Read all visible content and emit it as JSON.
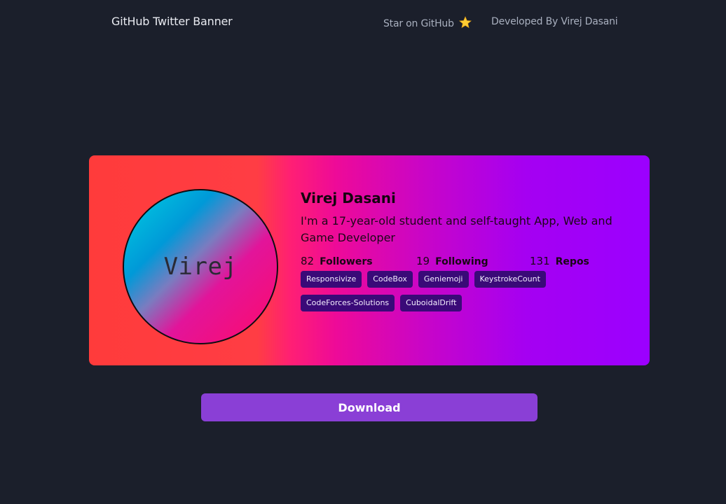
{
  "header": {
    "title": "GitHub Twitter Banner",
    "star_link": "Star on GitHub",
    "star_icon": "star-emoji",
    "developer_link": "Developed By Virej Dasani"
  },
  "banner": {
    "avatar_text": "Virej",
    "name": "Virej Dasani",
    "bio": "I'm a 17-year-old student and self-taught App, Web and Game Developer",
    "stats": {
      "followers_count": "82",
      "followers_label": "Followers",
      "following_count": "19",
      "following_label": "Following",
      "repos_count": "131",
      "repos_label": "Repos"
    },
    "repos": [
      "Responsivize",
      "CodeBox",
      "Geniemoji",
      "KeystrokeCount",
      "CodeForces-Solutions",
      "CuboidalDrift"
    ]
  },
  "download_label": "Download",
  "colors": {
    "background": "#1b1f2b",
    "button": "#8a3fd6",
    "repo_tag": "#3a0a78",
    "gradient_start": "#ff3b3b",
    "gradient_end": "#9b00ff"
  }
}
